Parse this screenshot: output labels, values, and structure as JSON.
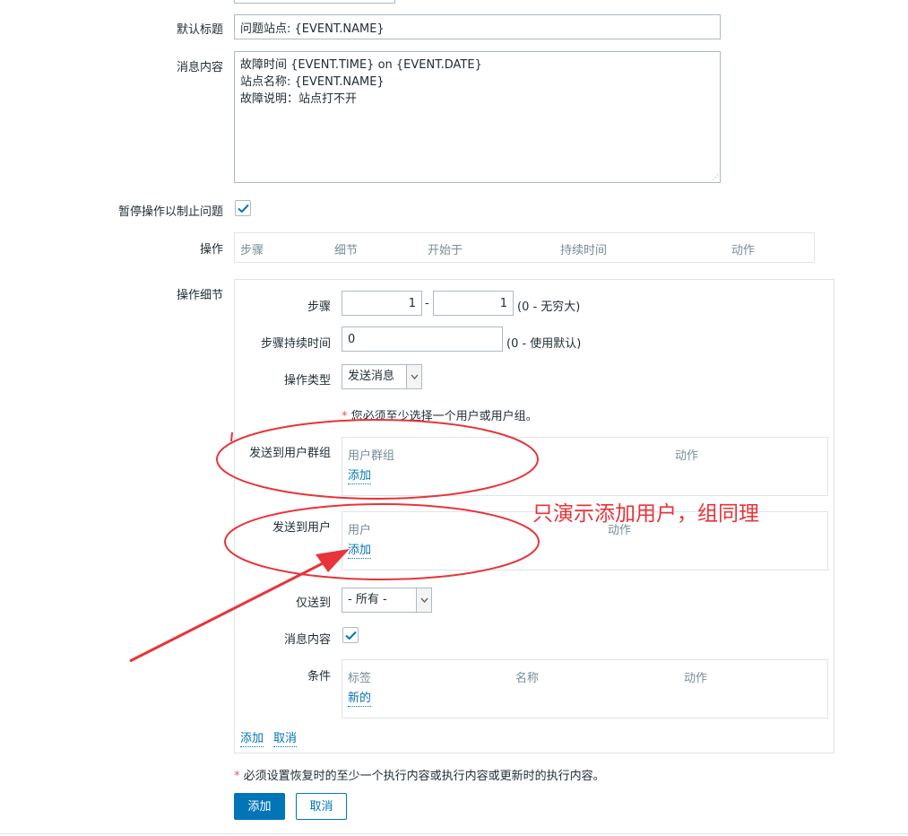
{
  "form": {
    "default_subject_label": "默认标题",
    "default_subject_value": "问题站点: {EVENT.NAME}",
    "message_label": "消息内容",
    "message_value": "故障时间 {EVENT.TIME} on {EVENT.DATE}\n站点名称: {EVENT.NAME}\n故障说明：站点打不开",
    "pause_label": "暂停操作以制止问题",
    "pause_checked": true,
    "operations_label": "操作",
    "operations_columns": [
      "步骤",
      "细节",
      "开始于",
      "持续时间",
      "动作"
    ],
    "details_label": "操作细节",
    "footer_note": "必须设置恢复时的至少一个执行内容或执行内容或更新时的执行内容。",
    "add_button": "添加",
    "cancel_button": "取消"
  },
  "details": {
    "steps_label": "步骤",
    "step_from": "1",
    "step_dash": "-",
    "step_to": "1",
    "steps_hint": "(0 - 无穷大)",
    "step_duration_label": "步骤持续时间",
    "step_duration_value": "0",
    "step_duration_hint": "(0 - 使用默认)",
    "op_type_label": "操作类型",
    "op_type_value": "发送消息",
    "required_hint": "您必须至少选择一个用户或用户组。",
    "send_groups_label": "发送到用户群组",
    "groups_columns": [
      "用户群组",
      "动作"
    ],
    "groups_add": "添加",
    "send_users_label": "发送到用户",
    "users_columns": [
      "用户",
      "动作"
    ],
    "users_add": "添加",
    "send_only_label": "仅送到",
    "send_only_value": "- 所有 -",
    "msg_content_label": "消息内容",
    "msg_content_checked": true,
    "conditions_label": "条件",
    "conditions_columns": [
      "标签",
      "名称",
      "动作"
    ],
    "conditions_new": "新的",
    "add_link": "添加",
    "cancel_link": "取消"
  },
  "annotation": {
    "text": "只演示添加用户，组同理"
  },
  "colors": {
    "accent": "#0275b8",
    "annotation": "#e8343a",
    "required": "#e45959"
  }
}
